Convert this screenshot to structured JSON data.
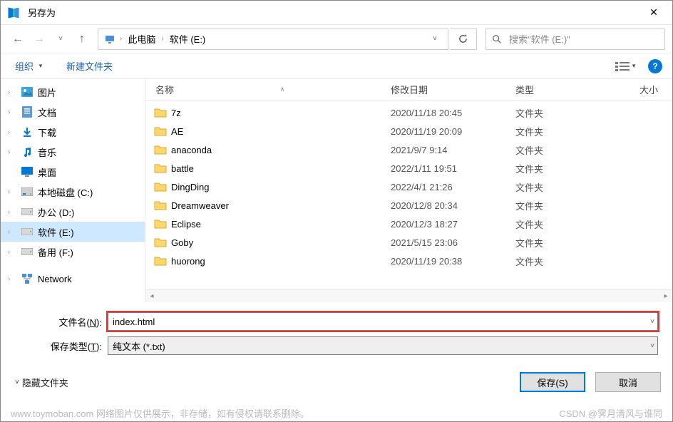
{
  "window": {
    "title": "另存为"
  },
  "breadcrumb": {
    "root_icon": "pc-icon",
    "parts": [
      "此电脑",
      "软件 (E:)"
    ]
  },
  "search": {
    "placeholder": "搜索\"软件 (E:)\""
  },
  "toolbar": {
    "organize": "组织",
    "new_folder": "新建文件夹"
  },
  "tree": [
    {
      "icon": "pictures",
      "label": "图片",
      "expandable": true
    },
    {
      "icon": "document",
      "label": "文档",
      "expandable": true
    },
    {
      "icon": "download",
      "label": "下载",
      "expandable": true
    },
    {
      "icon": "music",
      "label": "音乐",
      "expandable": true
    },
    {
      "icon": "desktop",
      "label": "桌面",
      "expandable": false
    },
    {
      "icon": "drive-c",
      "label": "本地磁盘 (C:)",
      "expandable": true
    },
    {
      "icon": "drive",
      "label": "办公 (D:)",
      "expandable": true
    },
    {
      "icon": "drive",
      "label": "软件 (E:)",
      "expandable": true,
      "selected": true
    },
    {
      "icon": "drive",
      "label": "备用 (F:)",
      "expandable": true
    },
    {
      "icon": "network",
      "label": "Network",
      "expandable": true,
      "top_gap": true
    }
  ],
  "columns": {
    "name": "名称",
    "date": "修改日期",
    "type": "类型",
    "size": "大小"
  },
  "rows": [
    {
      "name": "7z",
      "date": "2020/11/18 20:45",
      "type": "文件夹"
    },
    {
      "name": "AE",
      "date": "2020/11/19 20:09",
      "type": "文件夹"
    },
    {
      "name": "anaconda",
      "date": "2021/9/7 9:14",
      "type": "文件夹"
    },
    {
      "name": "battle",
      "date": "2022/1/11 19:51",
      "type": "文件夹"
    },
    {
      "name": "DingDing",
      "date": "2022/4/1 21:26",
      "type": "文件夹"
    },
    {
      "name": "Dreamweaver",
      "date": "2020/12/8 20:34",
      "type": "文件夹"
    },
    {
      "name": "Eclipse",
      "date": "2020/12/3 18:27",
      "type": "文件夹"
    },
    {
      "name": "Goby",
      "date": "2021/5/15 23:06",
      "type": "文件夹"
    },
    {
      "name": "huorong",
      "date": "2020/11/19 20:38",
      "type": "文件夹"
    }
  ],
  "form": {
    "filename_label_pre": "文件名(",
    "filename_label_u": "N",
    "filename_label_post": "):",
    "filename_value": "index.html",
    "filetype_label_pre": "保存类型(",
    "filetype_label_u": "T",
    "filetype_label_post": "):",
    "filetype_value": "纯文本 (*.txt)"
  },
  "footer": {
    "hide_folders": "隐藏文件夹",
    "save": "保存(S)",
    "cancel": "取消"
  },
  "watermark": {
    "left": "www.toymoban.com 网络图片仅供展示，非存储，如有侵权请联系删除。",
    "right": "CSDN @霁月清风与谁同"
  }
}
